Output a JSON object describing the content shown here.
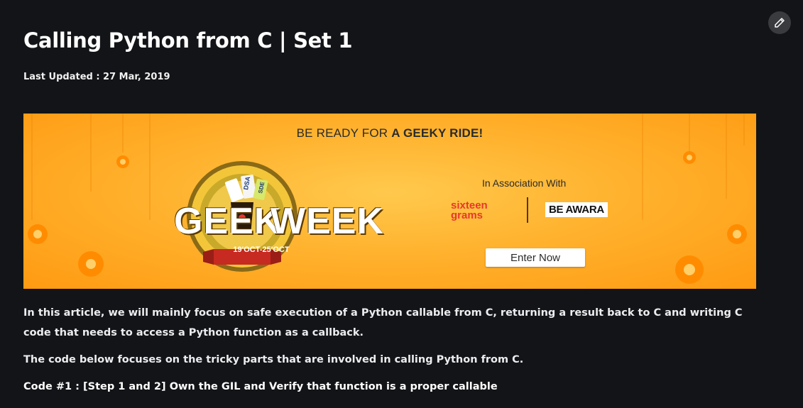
{
  "article": {
    "title": "Calling Python from C | Set 1",
    "last_updated": "Last Updated : 27 Mar, 2019",
    "paragraphs": [
      "In this article, we will mainly focus on safe execution of a Python callable from C, returning a result back to C and writing C code that needs to access a Python function as a callback.",
      "The code below focuses on the tricky parts that are involved in calling Python from C."
    ],
    "code_heading": "Code #1 : [Step 1 and 2] Own the GIL and Verify that function is a proper callable"
  },
  "toolbar": {
    "edit_icon": "pencil-icon"
  },
  "banner": {
    "headline_prefix": "BE READY FOR ",
    "headline_emphasis": "A GEEKY RIDE!",
    "logo_geek": "GEEK",
    "logo_week": "WEEK",
    "logo_dates": "19'OCT-25'OCT",
    "ticket_1": "DSA",
    "ticket_2": "SDE",
    "association": "In Association With",
    "sponsor_1_line1": "sixteen",
    "sponsor_1_line2": "grams",
    "sponsor_2": "BE AWARA",
    "cta": "Enter Now",
    "colors": {
      "background": "#ffb22e",
      "accent": "#e8372c",
      "badge_green": "#6b8e23"
    }
  }
}
